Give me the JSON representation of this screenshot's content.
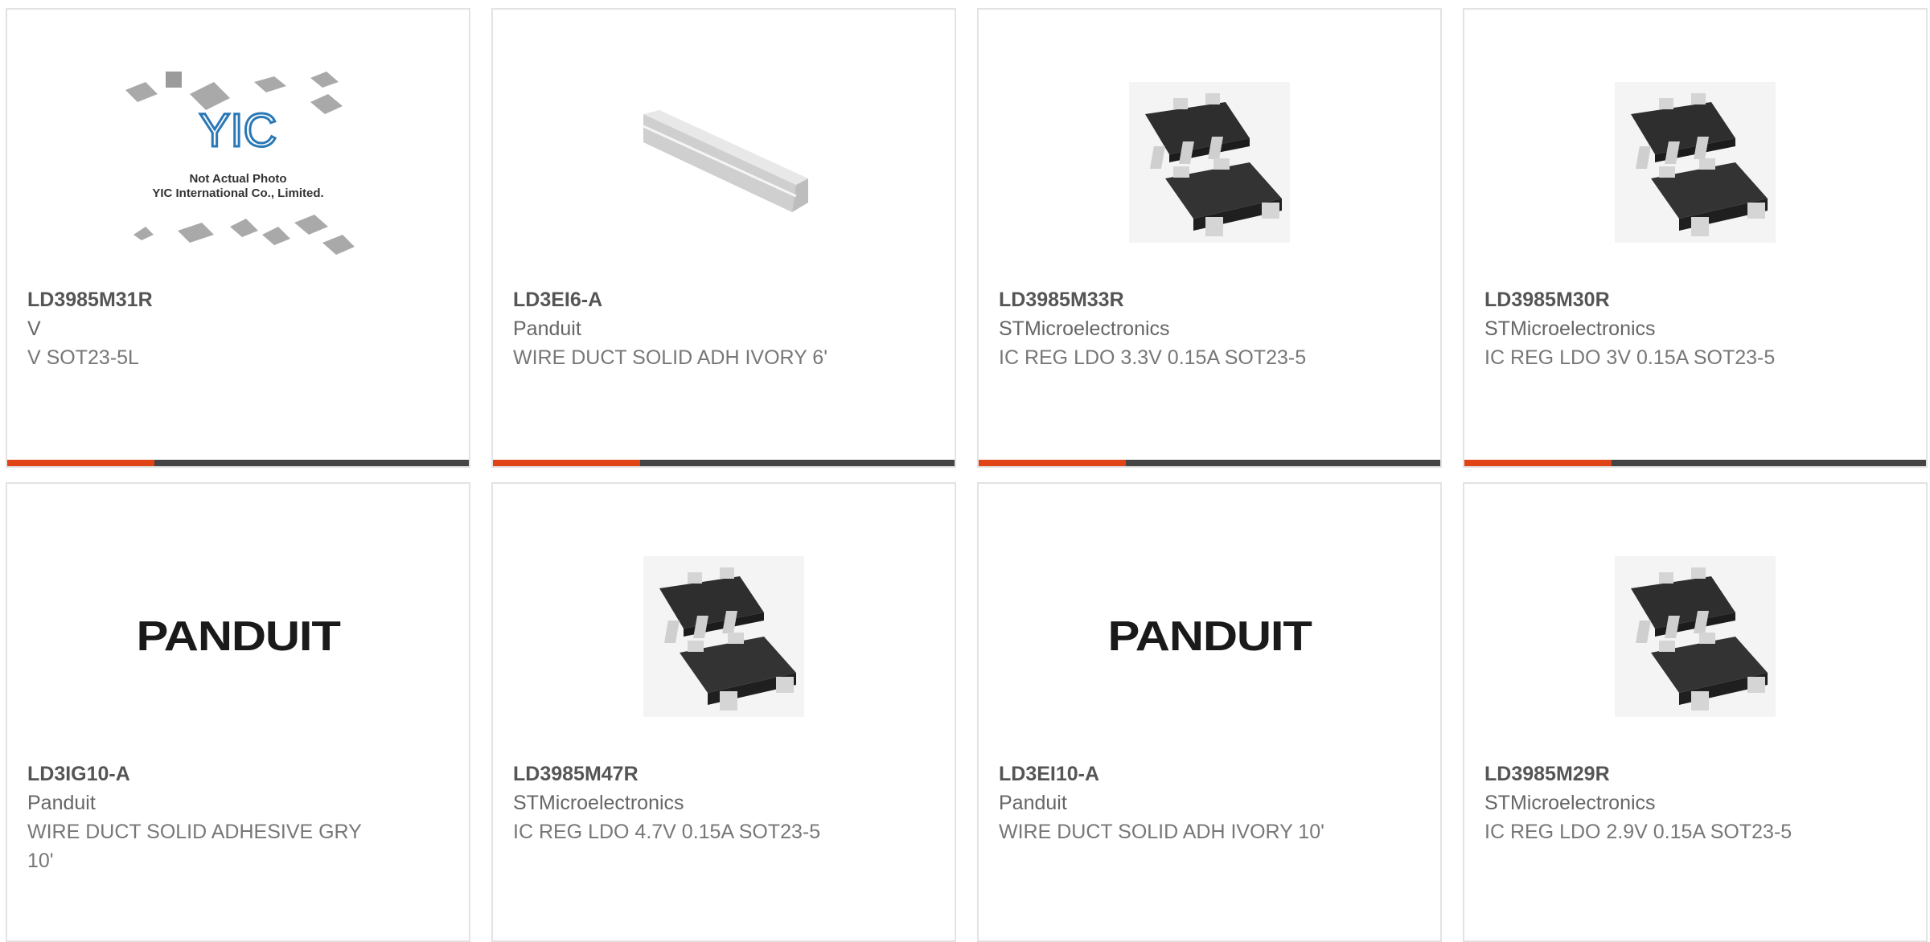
{
  "products": [
    {
      "part": "LD3985M31R",
      "maker": "V",
      "desc": "V SOT23-5L",
      "image": "not-actual-photo",
      "yic_logo": "YIC",
      "photo_note1": "Not Actual Photo",
      "photo_note2": "YIC International Co., Limited."
    },
    {
      "part": "LD3EI6-A",
      "maker": "Panduit",
      "desc": "WIRE DUCT SOLID ADH IVORY 6'",
      "image": "wire-duct"
    },
    {
      "part": "LD3985M33R",
      "maker": "STMicroelectronics",
      "desc": "IC REG LDO 3.3V 0.15A SOT23-5",
      "image": "sot23-5"
    },
    {
      "part": "LD3985M30R",
      "maker": "STMicroelectronics",
      "desc": "IC REG LDO 3V 0.15A SOT23-5",
      "image": "sot23-5"
    },
    {
      "part": "LD3IG10-A",
      "maker": "Panduit",
      "desc": "WIRE DUCT SOLID ADHESIVE GRY 10'",
      "image": "panduit-logo",
      "logo_text": "PANDUIT"
    },
    {
      "part": "LD3985M47R",
      "maker": "STMicroelectronics",
      "desc": "IC REG LDO 4.7V 0.15A SOT23-5",
      "image": "sot23-5"
    },
    {
      "part": "LD3EI10-A",
      "maker": "Panduit",
      "desc": "WIRE DUCT SOLID ADH IVORY 10'",
      "image": "panduit-logo",
      "logo_text": "PANDUIT"
    },
    {
      "part": "LD3985M29R",
      "maker": "STMicroelectronics",
      "desc": "IC REG LDO 2.9V 0.15A SOT23-5",
      "image": "sot23-5"
    }
  ],
  "colors": {
    "accent": "#e04316",
    "bar": "#444444",
    "border": "#e3e3e3"
  }
}
